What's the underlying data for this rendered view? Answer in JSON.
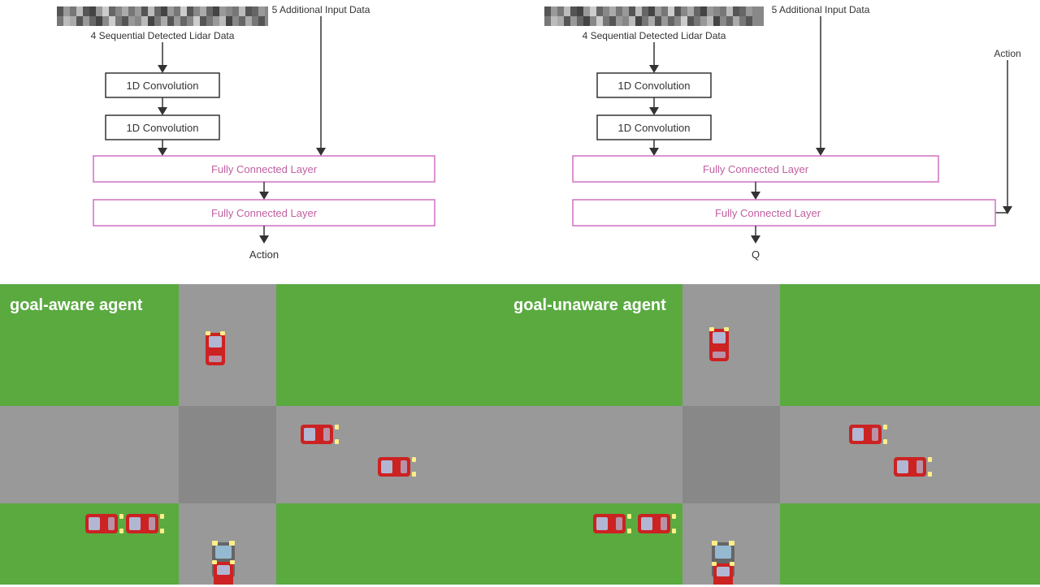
{
  "left": {
    "lidar_label": "4 Sequential Detected Lidar Data",
    "additional_input_label": "5 Additional Input Data",
    "conv1_label": "1D Convolution",
    "conv2_label": "1D Convolution",
    "fc1_label": "Fully Connected Layer",
    "fc2_label": "Fully Connected Layer",
    "output_label": "Action",
    "agent_label": "goal-aware agent"
  },
  "right": {
    "lidar_label": "4 Sequential Detected Lidar Data",
    "additional_input_label": "5 Additional Input Data",
    "action_input_label": "Action",
    "conv1_label": "1D Convolution",
    "conv2_label": "1D Convolution",
    "fc1_label": "Fully Connected Layer",
    "fc2_label": "Fully Connected Layer",
    "output_label": "Q",
    "agent_label": "goal-unaware agent"
  }
}
